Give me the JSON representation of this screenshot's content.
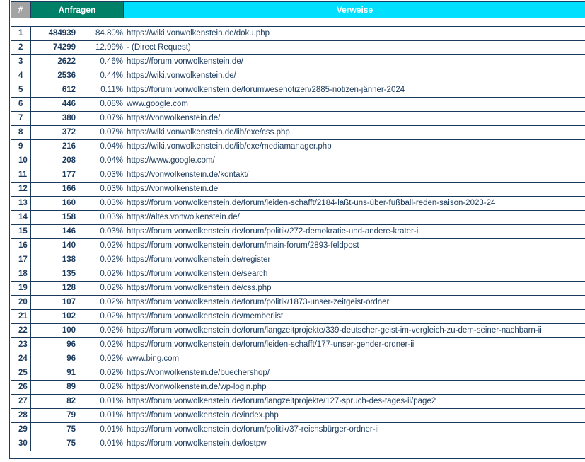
{
  "header": {
    "num": "#",
    "requests": "Anfragen",
    "referrers": "Verweise"
  },
  "colors": {
    "num_header": "#a3a3a3",
    "requests_header": "#008066",
    "referrers_header": "#00dffd",
    "text": "#1b3a5c"
  },
  "rows": [
    {
      "num": "1",
      "count": "484939",
      "pct": "84.80%",
      "url": "https://wiki.vonwolkenstein.de/doku.php"
    },
    {
      "num": "2",
      "count": "74299",
      "pct": "12.99%",
      "url": "- (Direct Request)"
    },
    {
      "num": "3",
      "count": "2622",
      "pct": "0.46%",
      "url": "https://forum.vonwolkenstein.de/"
    },
    {
      "num": "4",
      "count": "2536",
      "pct": "0.44%",
      "url": "https://wiki.vonwolkenstein.de/"
    },
    {
      "num": "5",
      "count": "612",
      "pct": "0.11%",
      "url": "https://forum.vonwolkenstein.de/forumwesenotizen/2885-notizen-jänner-2024"
    },
    {
      "num": "6",
      "count": "446",
      "pct": "0.08%",
      "url": "www.google.com"
    },
    {
      "num": "7",
      "count": "380",
      "pct": "0.07%",
      "url": "https://vonwolkenstein.de/"
    },
    {
      "num": "8",
      "count": "372",
      "pct": "0.07%",
      "url": "https://wiki.vonwolkenstein.de/lib/exe/css.php"
    },
    {
      "num": "9",
      "count": "216",
      "pct": "0.04%",
      "url": "https://wiki.vonwolkenstein.de/lib/exe/mediamanager.php"
    },
    {
      "num": "10",
      "count": "208",
      "pct": "0.04%",
      "url": "https://www.google.com/"
    },
    {
      "num": "11",
      "count": "177",
      "pct": "0.03%",
      "url": "https://vonwolkenstein.de/kontakt/"
    },
    {
      "num": "12",
      "count": "166",
      "pct": "0.03%",
      "url": "https://vonwolkenstein.de"
    },
    {
      "num": "13",
      "count": "160",
      "pct": "0.03%",
      "url": "https://forum.vonwolkenstein.de/forum/leiden-schafft/2184-laßt-uns-über-fußball-reden-saison-2023-24"
    },
    {
      "num": "14",
      "count": "158",
      "pct": "0.03%",
      "url": "https://altes.vonwolkenstein.de/"
    },
    {
      "num": "15",
      "count": "146",
      "pct": "0.03%",
      "url": "https://forum.vonwolkenstein.de/forum/politik/272-demokratie-und-andere-krater-ii"
    },
    {
      "num": "16",
      "count": "140",
      "pct": "0.02%",
      "url": "https://forum.vonwolkenstein.de/forum/main-forum/2893-feldpost"
    },
    {
      "num": "17",
      "count": "138",
      "pct": "0.02%",
      "url": "https://forum.vonwolkenstein.de/register"
    },
    {
      "num": "18",
      "count": "135",
      "pct": "0.02%",
      "url": "https://forum.vonwolkenstein.de/search"
    },
    {
      "num": "19",
      "count": "128",
      "pct": "0.02%",
      "url": "https://forum.vonwolkenstein.de/css.php"
    },
    {
      "num": "20",
      "count": "107",
      "pct": "0.02%",
      "url": "https://forum.vonwolkenstein.de/forum/politik/1873-unser-zeitgeist-ordner"
    },
    {
      "num": "21",
      "count": "102",
      "pct": "0.02%",
      "url": "https://forum.vonwolkenstein.de/memberlist"
    },
    {
      "num": "22",
      "count": "100",
      "pct": "0.02%",
      "url": "https://forum.vonwolkenstein.de/forum/langzeitprojekte/339-deutscher-geist-im-vergleich-zu-dem-seiner-nachbarn-ii"
    },
    {
      "num": "23",
      "count": "96",
      "pct": "0.02%",
      "url": "https://forum.vonwolkenstein.de/forum/leiden-schafft/177-unser-gender-ordner-ii"
    },
    {
      "num": "24",
      "count": "96",
      "pct": "0.02%",
      "url": "www.bing.com"
    },
    {
      "num": "25",
      "count": "91",
      "pct": "0.02%",
      "url": "https://vonwolkenstein.de/buechershop/"
    },
    {
      "num": "26",
      "count": "89",
      "pct": "0.02%",
      "url": "https://vonwolkenstein.de/wp-login.php"
    },
    {
      "num": "27",
      "count": "82",
      "pct": "0.01%",
      "url": "https://forum.vonwolkenstein.de/forum/langzeitprojekte/127-spruch-des-tages-ii/page2"
    },
    {
      "num": "28",
      "count": "79",
      "pct": "0.01%",
      "url": "https://forum.vonwolkenstein.de/index.php"
    },
    {
      "num": "29",
      "count": "75",
      "pct": "0.01%",
      "url": "https://forum.vonwolkenstein.de/forum/politik/37-reichsbürger-ordner-ii"
    },
    {
      "num": "30",
      "count": "75",
      "pct": "0.01%",
      "url": "https://forum.vonwolkenstein.de/lostpw"
    }
  ]
}
